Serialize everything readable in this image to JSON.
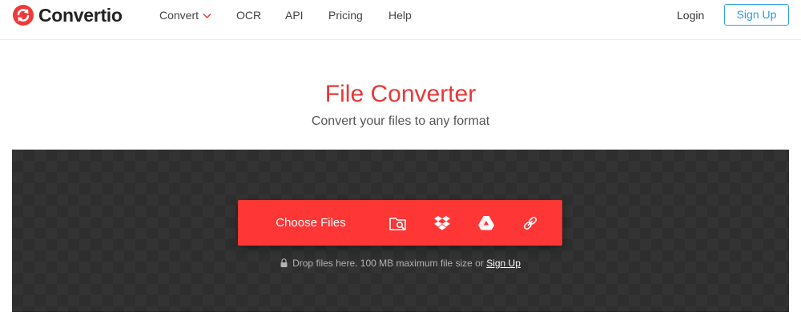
{
  "header": {
    "brand": "Convertio",
    "nav": [
      {
        "label": "Convert",
        "has_dropdown": true
      },
      {
        "label": "OCR"
      },
      {
        "label": "API"
      },
      {
        "label": "Pricing"
      },
      {
        "label": "Help"
      }
    ],
    "login_label": "Login",
    "signup_label": "Sign Up"
  },
  "hero": {
    "title": "File Converter",
    "subtitle": "Convert your files to any format"
  },
  "upload": {
    "choose_label": "Choose Files",
    "sources": [
      "folder-search-icon",
      "dropbox-icon",
      "google-drive-icon",
      "url-link-icon"
    ],
    "note_text": "Drop files here. 100 MB maximum file size or",
    "note_link": "Sign Up"
  },
  "colors": {
    "brand_red": "#ff3636",
    "title_red": "#e83737",
    "signup_blue": "#2d9be0",
    "dropzone_bg": "#333333"
  }
}
